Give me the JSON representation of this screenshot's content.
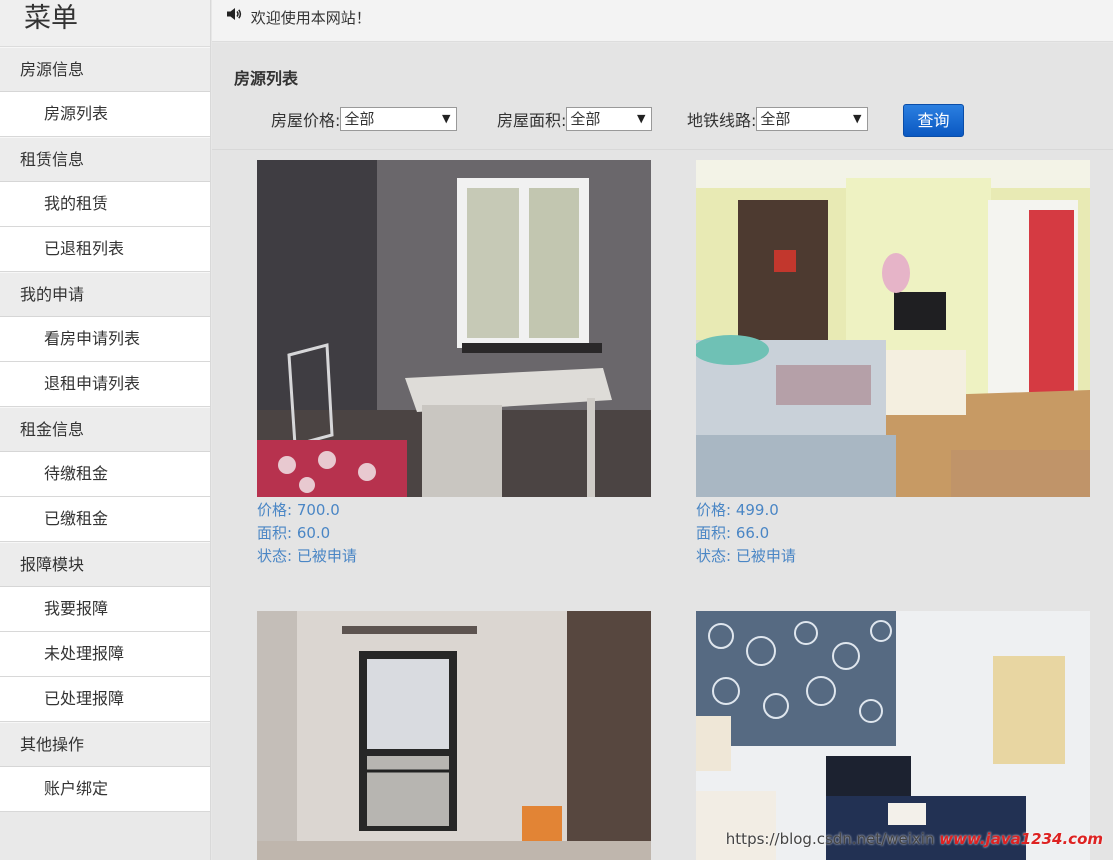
{
  "sidebar": {
    "title": "菜单",
    "groups": [
      {
        "label": "房源信息",
        "items": [
          "房源列表"
        ]
      },
      {
        "label": "租赁信息",
        "items": [
          "我的租赁",
          "已退租列表"
        ]
      },
      {
        "label": "我的申请",
        "items": [
          "看房申请列表",
          "退租申请列表"
        ]
      },
      {
        "label": "租金信息",
        "items": [
          "待缴租金",
          "已缴租金"
        ]
      },
      {
        "label": "报障模块",
        "items": [
          "我要报障",
          "未处理报障",
          "已处理报障"
        ]
      },
      {
        "label": "其他操作",
        "items": [
          "账户绑定"
        ]
      }
    ]
  },
  "topbar": {
    "welcome": "欢迎使用本网站！",
    "icon": "speaker-icon"
  },
  "main": {
    "title": "房源列表",
    "filters": [
      {
        "label": "房屋价格:",
        "value": "全部"
      },
      {
        "label": "房屋面积:",
        "value": "全部"
      },
      {
        "label": "地铁线路:",
        "value": "全部"
      }
    ],
    "search_label": "查询",
    "listings": [
      {
        "price": "价格: 700.0",
        "area": "面积: 60.0",
        "status": "状态: 已被申请"
      },
      {
        "price": "价格: 499.0",
        "area": "面积: 66.0",
        "status": "状态: 已被申请"
      },
      {
        "price": "",
        "area": "",
        "status": ""
      },
      {
        "price": "",
        "area": "",
        "status": ""
      }
    ]
  },
  "watermark": {
    "url": "https://blog.csdn.net/weixin",
    "brand": "www.java1234.com"
  },
  "colors": {
    "accent": "#0a58c2",
    "info_text": "#4a86c5"
  }
}
